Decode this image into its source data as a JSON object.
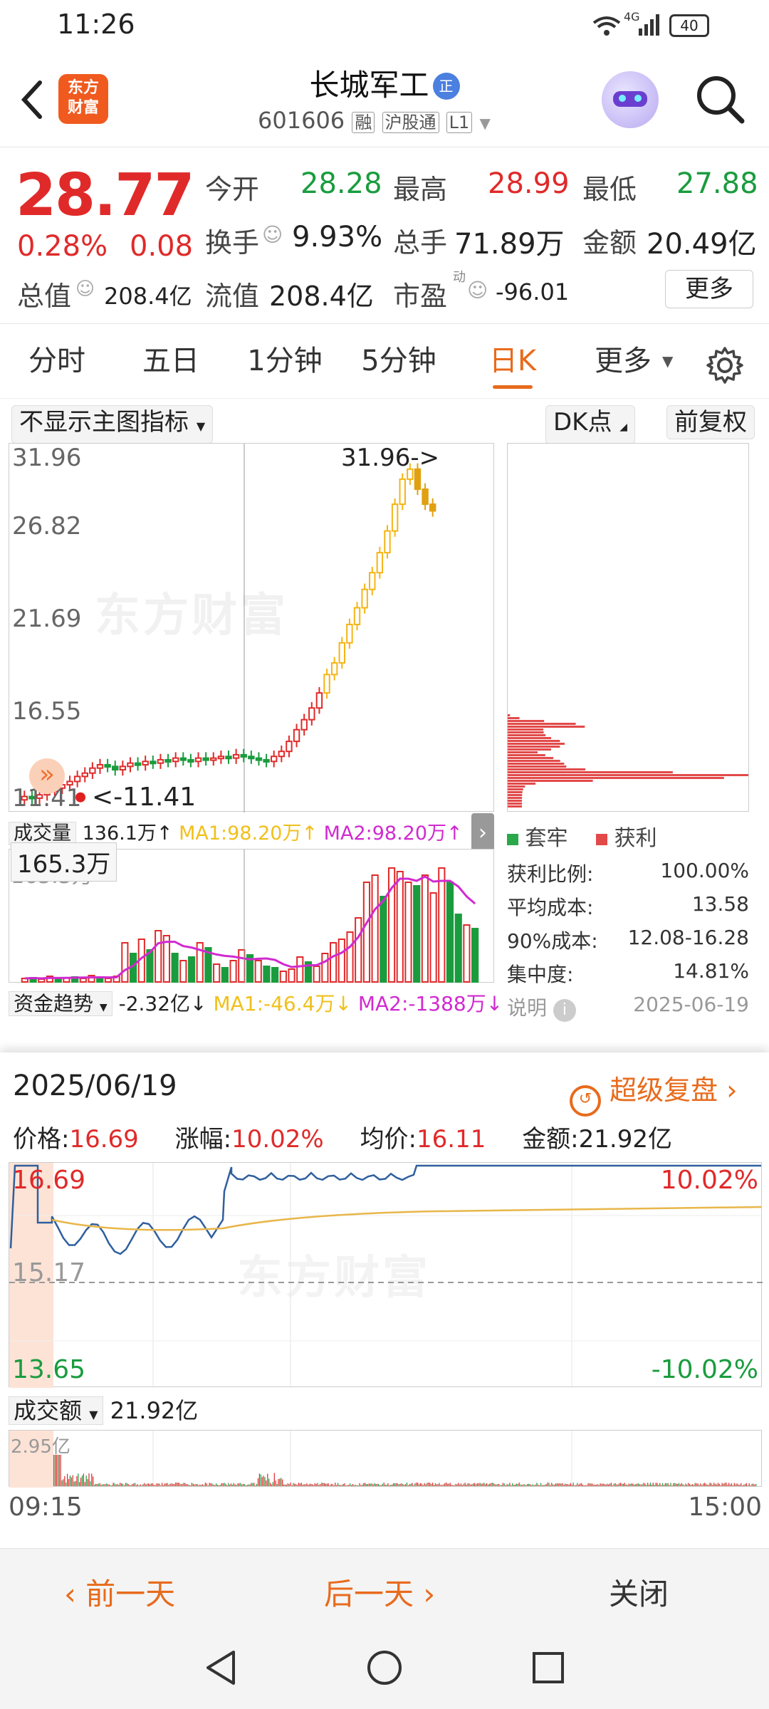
{
  "status": {
    "time": "11:26",
    "network": "4G",
    "battery": "40"
  },
  "header": {
    "logo_line1": "东方",
    "logo_line2": "财富",
    "title": "长城军工",
    "badge": "正",
    "code": "601606",
    "tags": [
      "融",
      "沪股通",
      "L1"
    ]
  },
  "quote": {
    "price": "28.77",
    "pct": "0.28%",
    "change": "0.08",
    "open_label": "今开",
    "open": "28.28",
    "high_label": "最高",
    "high": "28.99",
    "low_label": "最低",
    "low": "27.88",
    "turnover_label": "换手",
    "turnover": "9.93%",
    "volume_label": "总手",
    "volume": "71.89万",
    "amount_label": "金额",
    "amount": "20.49亿",
    "mktcap_label": "总值",
    "mktcap": "208.4亿",
    "float_label": "流值",
    "float": "208.4亿",
    "pe_label": "市盈",
    "pe_sup": "动",
    "pe": "-96.01",
    "more_button": "更多"
  },
  "tabs": [
    {
      "label": "分时"
    },
    {
      "label": "五日"
    },
    {
      "label": "1分钟"
    },
    {
      "label": "5分钟"
    },
    {
      "label": "日K"
    },
    {
      "label": "更多"
    }
  ],
  "kline": {
    "indicator_select": "不显示主图指标",
    "dk_button": "DK点",
    "adjust_button": "前复权",
    "y_ticks": [
      "31.96",
      "26.82",
      "21.69",
      "16.55",
      "11.41"
    ],
    "max_label": "31.96->",
    "min_label": "<-11.41"
  },
  "chip": {
    "legend_trapped": "套牢",
    "legend_profit": "获利",
    "rows": [
      {
        "label": "获利比例:",
        "value": "100.00%"
      },
      {
        "label": "平均成本:",
        "value": "13.58"
      },
      {
        "label": "90%成本:",
        "value": "12.08-16.28"
      },
      {
        "label": "集中度:",
        "value": "14.81%"
      }
    ],
    "note_label": "说明",
    "date": "2025-06-19"
  },
  "volume": {
    "select": "成交量",
    "value": "136.1万↑",
    "ma1": "MA1:98.20万↑",
    "ma2": "MA2:98.20万↑",
    "tooltip": "165.3万",
    "axis_label": "165.3万"
  },
  "capital": {
    "select": "资金趋势",
    "value": "-2.32亿↓",
    "ma1": "MA1:-46.4万↓",
    "ma2": "MA2:-1388万↓"
  },
  "popup": {
    "date": "2025/06/19",
    "replay": "超级复盘",
    "price_label": "价格:",
    "price": "16.69",
    "chg_label": "涨幅:",
    "chg": "10.02%",
    "avg_label": "均价:",
    "avg": "16.11",
    "amt_label": "金额:",
    "amt": "21.92亿",
    "y_top": "16.69",
    "y_mid": "15.17",
    "y_bot": "13.65",
    "pct_top": "10.02%",
    "pct_bot": "-10.02%",
    "turnover_select": "成交额",
    "turnover_value": "21.92亿",
    "bar_max": "2.95亿",
    "time_start": "09:15",
    "time_end": "15:00"
  },
  "footer": {
    "prev": "前一天",
    "next": "后一天",
    "close": "关闭"
  },
  "watermark": "东方财富",
  "colors": {
    "up": "#e02a2a",
    "down": "#1a9c3e",
    "accent": "#e86b1c",
    "ma1": "#f0c01b",
    "ma2": "#d02ad0",
    "price_line": "#2f5f9e",
    "avg_line": "#e8b64a"
  }
}
